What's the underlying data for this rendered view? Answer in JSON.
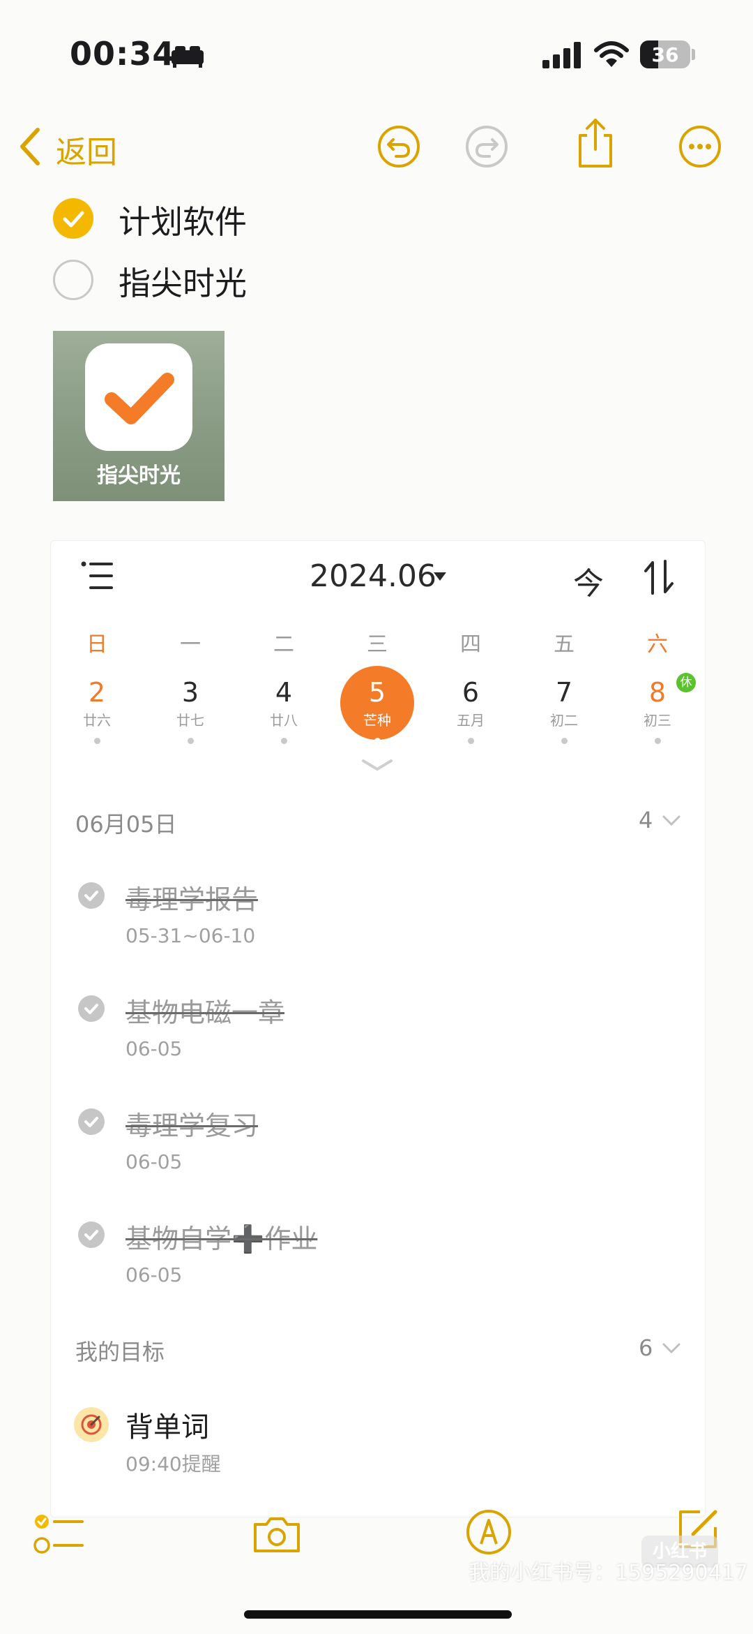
{
  "status_bar": {
    "time": "00:34",
    "battery_level": "36",
    "battery_fraction": 0.36,
    "icons": [
      "bed-icon",
      "cellular-signal-icon",
      "wifi-icon",
      "battery-icon"
    ]
  },
  "nav": {
    "back_label": "返回",
    "icons": [
      "chevron-left-icon",
      "undo-icon",
      "redo-icon",
      "share-icon",
      "more-icon"
    ]
  },
  "checklist": [
    {
      "label": "计划软件",
      "checked": true
    },
    {
      "label": "指尖时光",
      "checked": false
    }
  ],
  "app_image": {
    "caption": "指尖时光",
    "icon": "checkmark-icon"
  },
  "calendar": {
    "month": "2024.06",
    "today_label": "今",
    "weekdays": [
      "日",
      "一",
      "二",
      "三",
      "四",
      "五",
      "六"
    ],
    "days": [
      {
        "num": "2",
        "lunar": "廿六",
        "weekend": true
      },
      {
        "num": "3",
        "lunar": "廿七",
        "weekend": false
      },
      {
        "num": "4",
        "lunar": "廿八",
        "weekend": false
      },
      {
        "num": "5",
        "lunar": "芒种",
        "weekend": false,
        "selected": true
      },
      {
        "num": "6",
        "lunar": "五月",
        "weekend": false
      },
      {
        "num": "7",
        "lunar": "初二",
        "weekend": false
      },
      {
        "num": "8",
        "lunar": "初三",
        "weekend": true
      }
    ],
    "holiday_badge": "休",
    "colors": {
      "accent": "#f47b27",
      "weekend": "#f07a2a",
      "holiday": "#5cc12e",
      "notes_yellow": "#d9a400"
    }
  },
  "tasks_section": {
    "date_label": "06月05日",
    "count": "4",
    "tasks": [
      {
        "title": "毒理学报告",
        "date": "05-31~06-10",
        "done": true
      },
      {
        "title": "基物电磁一章",
        "date": "06-05",
        "done": true
      },
      {
        "title": "毒理学复习",
        "date": "06-05",
        "done": true
      },
      {
        "title": "基物自学➕作业",
        "date": "06-05",
        "done": true
      }
    ]
  },
  "goals_section": {
    "label": "我的目标",
    "count": "6",
    "goals": [
      {
        "title": "背单词",
        "reminder": "09:40提醒",
        "icon": "target-icon"
      }
    ]
  },
  "toolbar": {
    "icons": [
      "checklist-icon",
      "camera-icon",
      "markup-icon",
      "compose-icon"
    ]
  },
  "watermark": {
    "text": "我的小红书号：1595290417",
    "logo_text": "小红书"
  }
}
